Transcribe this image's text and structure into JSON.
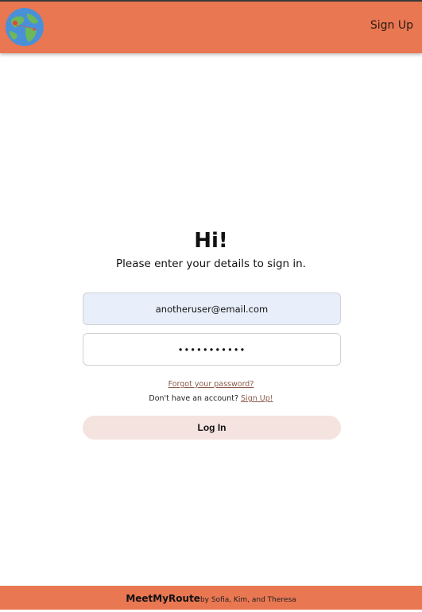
{
  "header": {
    "logo_icon": "globe-icon",
    "nav_signup": "Sign Up",
    "bg_color": "#e97752"
  },
  "login": {
    "greeting": "Hi!",
    "subtitle": "Please enter your details to sign in.",
    "email_value": "anotheruser@email.com",
    "password_value": "•••••••••••",
    "forgot_link": "Forgot your password?",
    "no_account_text": "Don't have an account?",
    "signup_link": "Sign Up!",
    "login_button": "Log In"
  },
  "footer": {
    "brand": "MeetMyRoute",
    "credits": "by Sofia, Kim, and Theresa"
  }
}
